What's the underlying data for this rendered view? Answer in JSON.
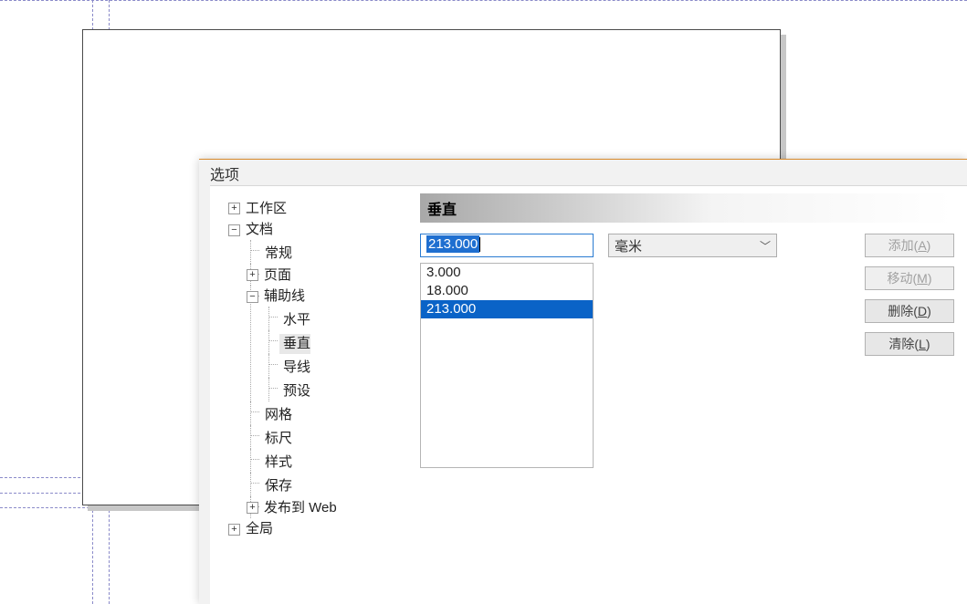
{
  "dialog": {
    "title": "选项"
  },
  "tree": {
    "workspace": {
      "label": "工作区",
      "exp": "+"
    },
    "document": {
      "label": "文档",
      "exp": "−",
      "general": "常规",
      "page": {
        "label": "页面",
        "exp": "+"
      },
      "guides": {
        "label": "辅助线",
        "exp": "−",
        "horiz": "水平",
        "vert": "垂直",
        "guide": "导线",
        "preset": "预设"
      },
      "grid": "网格",
      "ruler": "标尺",
      "style": "样式",
      "save": "保存",
      "web": {
        "label": "发布到 Web",
        "exp": "+"
      }
    },
    "global": {
      "label": "全局",
      "exp": "+"
    }
  },
  "panel": {
    "title": "垂直",
    "value": "213.000",
    "unit": "毫米",
    "list": [
      "3.000",
      "18.000",
      "213.000"
    ],
    "selectedIndex": 2
  },
  "buttons": {
    "add": {
      "label": "添加",
      "hotkey": "A"
    },
    "move": {
      "label": "移动",
      "hotkey": "M"
    },
    "delete": {
      "label": "删除",
      "hotkey": "D"
    },
    "clear": {
      "label": "清除",
      "hotkey": "L"
    }
  }
}
